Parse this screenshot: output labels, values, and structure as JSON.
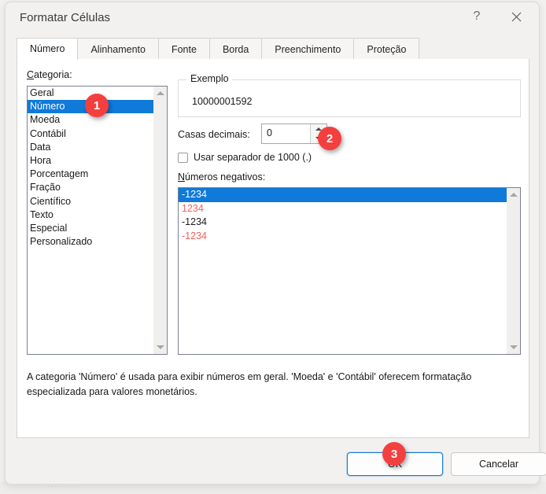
{
  "window": {
    "title": "Formatar Células",
    "help_icon": "question-mark-icon",
    "help_label": "?",
    "close_icon": "close-icon"
  },
  "tabs": [
    {
      "label": "Número",
      "active": true
    },
    {
      "label": "Alinhamento",
      "active": false
    },
    {
      "label": "Fonte",
      "active": false
    },
    {
      "label": "Borda",
      "active": false
    },
    {
      "label": "Preenchimento",
      "active": false
    },
    {
      "label": "Proteção",
      "active": false
    }
  ],
  "category": {
    "label": "Categoria:",
    "items": [
      "Geral",
      "Número",
      "Moeda",
      "Contábil",
      "Data",
      "Hora",
      "Porcentagem",
      "Fração",
      "Científico",
      "Texto",
      "Especial",
      "Personalizado"
    ],
    "selected_index": 1,
    "scroll_up_icon": "triangle-up-icon",
    "scroll_down_icon": "triangle-down-icon"
  },
  "example": {
    "legend": "Exemplo",
    "value": "10000001592"
  },
  "decimals": {
    "label": "Casas decimais:",
    "value": "0",
    "spinner_up_icon": "spinner-up-icon",
    "spinner_down_icon": "spinner-down-icon"
  },
  "thousands_separator": {
    "label": "Usar separador de 1000 (.)",
    "checked": false
  },
  "negative_numbers": {
    "label": "Números negativos:",
    "items": [
      {
        "text": "-1234",
        "color": "#1a1919",
        "selected": true
      },
      {
        "text": "1234",
        "color": "#f4605a",
        "selected": false
      },
      {
        "text": "-1234",
        "color": "#1a1919",
        "selected": false
      },
      {
        "text": "-1234",
        "color": "#f4605a",
        "selected": false
      }
    ],
    "scroll_up_icon": "triangle-up-icon",
    "scroll_down_icon": "triangle-down-icon"
  },
  "description": "A categoria 'Número' é usada para exibir números em geral. 'Moeda' e 'Contábil' oferecem formatação especializada para valores monetários.",
  "footer": {
    "ok_label": "OK",
    "cancel_label": "Cancelar"
  },
  "step_badges": [
    {
      "number": "1",
      "color": "#f43f3f"
    },
    {
      "number": "2",
      "color": "#f43f3f"
    },
    {
      "number": "3",
      "color": "#f43f3f"
    }
  ],
  "background": {
    "ghost_text": "····· ···"
  }
}
